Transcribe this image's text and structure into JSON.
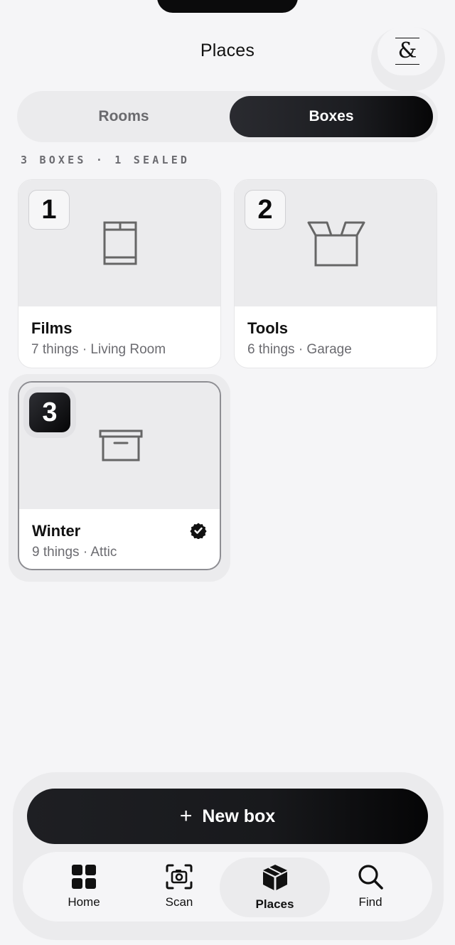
{
  "header": {
    "title": "Places",
    "logo_glyph": "&"
  },
  "segmented": {
    "options": [
      "Rooms",
      "Boxes"
    ],
    "selected": "Boxes"
  },
  "summary": "3 BOXES · 1 SEALED",
  "boxes": [
    {
      "number": "1",
      "name": "Films",
      "meta": "7 things · Living Room",
      "icon": "bookshelf-icon",
      "sealed": false,
      "selected": false
    },
    {
      "number": "2",
      "name": "Tools",
      "meta": "6 things · Garage",
      "icon": "open-box-icon",
      "sealed": false,
      "selected": false
    },
    {
      "number": "3",
      "name": "Winter",
      "meta": "9 things · Attic",
      "icon": "archive-box-icon",
      "sealed": true,
      "selected": true
    }
  ],
  "cta": {
    "plus": "+",
    "label": "New box"
  },
  "tabs": [
    {
      "label": "Home",
      "icon": "grid-icon"
    },
    {
      "label": "Scan",
      "icon": "camera-scan-icon"
    },
    {
      "label": "Places",
      "icon": "cube-icon",
      "active": true
    },
    {
      "label": "Find",
      "icon": "search-icon"
    }
  ],
  "colors": {
    "background": "#f5f5f7",
    "surface": "#ebebed",
    "primary_dark": "#111111",
    "muted_text": "#6b6b70"
  }
}
